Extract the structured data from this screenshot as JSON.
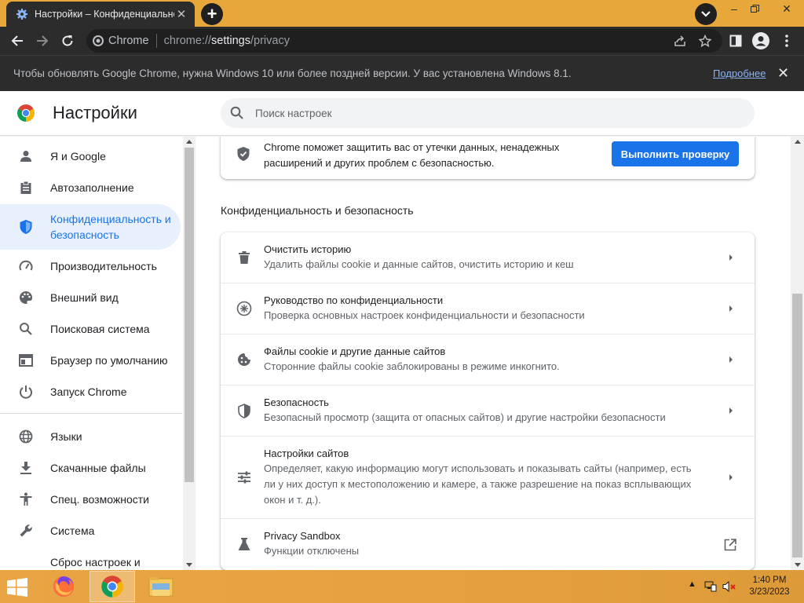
{
  "browser": {
    "tab_title": "Настройки – Конфиденциальность",
    "omnibox_chip": "Chrome",
    "url_prefix": "chrome://",
    "url_path": "settings",
    "url_suffix": "/privacy"
  },
  "infobar": {
    "message": "Чтобы обновлять Google Chrome, нужна Windows 10 или более поздней версии. У вас установлена Windows 8.1.",
    "link": "Подробнее"
  },
  "header": {
    "title": "Настройки",
    "search_placeholder": "Поиск настроек"
  },
  "sidebar": {
    "items": [
      {
        "label": "Я и Google",
        "icon": "person-icon"
      },
      {
        "label": "Автозаполнение",
        "icon": "clipboard-icon"
      },
      {
        "label": "Конфиденциальность и безопасность",
        "icon": "shield-icon",
        "active": true
      },
      {
        "label": "Производительность",
        "icon": "speedometer-icon"
      },
      {
        "label": "Внешний вид",
        "icon": "palette-icon"
      },
      {
        "label": "Поисковая система",
        "icon": "search-icon"
      },
      {
        "label": "Браузер по умолчанию",
        "icon": "browser-icon"
      },
      {
        "label": "Запуск Chrome",
        "icon": "power-icon"
      },
      {
        "label": "Языки",
        "icon": "globe-icon"
      },
      {
        "label": "Скачанные файлы",
        "icon": "download-icon"
      },
      {
        "label": "Спец. возможности",
        "icon": "accessibility-icon"
      },
      {
        "label": "Система",
        "icon": "wrench-icon"
      },
      {
        "label": "Сброс настроек и",
        "icon": "reset-icon"
      }
    ]
  },
  "safety_check": {
    "text": "Chrome поможет защитить вас от утечки данных, ненадежных расширений и других проблем с безопасностью.",
    "button": "Выполнить проверку"
  },
  "privacy": {
    "section_title": "Конфиденциальность и безопасность",
    "rows": [
      {
        "title": "Очистить историю",
        "subtitle": "Удалить файлы cookie и данные сайтов, очистить историю и кеш",
        "icon": "trash-icon"
      },
      {
        "title": "Руководство по конфиденциальности",
        "subtitle": "Проверка основных настроек конфиденциальности и безопасности",
        "icon": "compass-icon"
      },
      {
        "title": "Файлы cookie и другие данные сайтов",
        "subtitle": "Сторонние файлы cookie заблокированы в режиме инкогнито.",
        "icon": "cookie-icon"
      },
      {
        "title": "Безопасность",
        "subtitle": "Безопасный просмотр (защита от опасных сайтов) и другие настройки безопасности",
        "icon": "security-shield-icon"
      },
      {
        "title": "Настройки сайтов",
        "subtitle": "Определяет, какую информацию могут использовать и показывать сайты (например, есть ли у них доступ к местоположению и камере, а также разрешение на показ всплывающих окон и т. д.).",
        "icon": "sliders-icon"
      },
      {
        "title": "Privacy Sandbox",
        "subtitle": "Функции отключены",
        "icon": "flask-icon"
      }
    ]
  },
  "taskbar": {
    "time": "1:40 PM",
    "date": "3/23/2023"
  },
  "colors": {
    "accent": "#1a73e8",
    "frame": "#e8a73a",
    "toolbar": "#2c2c2c"
  }
}
